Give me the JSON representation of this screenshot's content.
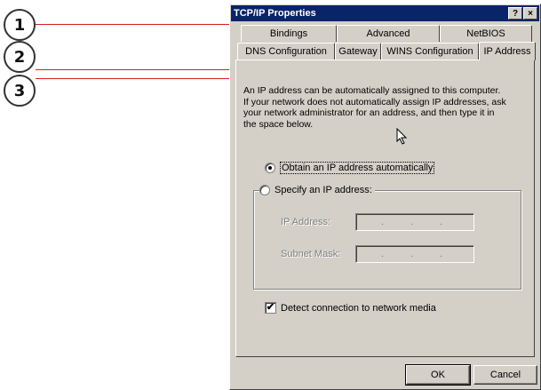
{
  "callouts": [
    "1",
    "2",
    "3"
  ],
  "window": {
    "title": "TCP/IP Properties",
    "help_button": "?",
    "close_button": "×"
  },
  "tabs_back": [
    "Bindings",
    "Advanced",
    "NetBIOS"
  ],
  "tabs_front": [
    "DNS Configuration",
    "Gateway",
    "WINS Configuration",
    "IP Address"
  ],
  "panel": {
    "description_lines": [
      "An IP address can be automatically assigned to this computer.",
      "If your network does not automatically assign IP addresses, ask",
      "your network administrator for an address, and then type it in",
      "the space below."
    ],
    "obtain_label": "Obtain an IP address automatically",
    "specify_label": "Specify an IP address:",
    "ip_address_label": "IP Address:",
    "subnet_mask_label": "Subnet Mask:",
    "ip_separator": ".",
    "detect_label": "Detect connection to network media",
    "detect_check": "✔"
  },
  "buttons": {
    "ok": "OK",
    "cancel": "Cancel"
  },
  "colors": {
    "titlebar": "#0a246a",
    "face": "#d4d0c8",
    "callout_line": "#d62020"
  }
}
